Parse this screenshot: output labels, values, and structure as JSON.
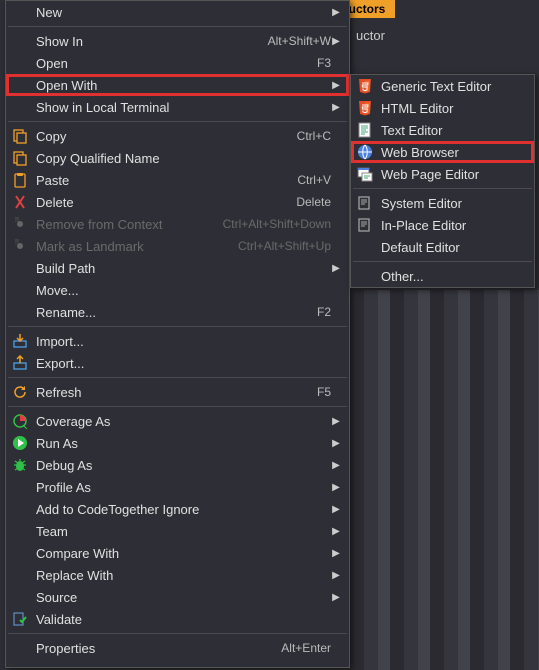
{
  "background": {
    "tab_label": "Constructors",
    "sub_label": "uctor"
  },
  "main_menu": [
    {
      "label": "New",
      "submenu": true
    },
    {
      "sep": true
    },
    {
      "label": "Show In",
      "shortcut": "Alt+Shift+W",
      "submenu": true
    },
    {
      "label": "Open",
      "shortcut": "F3"
    },
    {
      "label": "Open With",
      "submenu": true,
      "highlight": true
    },
    {
      "label": "Show in Local Terminal",
      "submenu": true
    },
    {
      "sep": true
    },
    {
      "icon": "copy",
      "label": "Copy",
      "shortcut": "Ctrl+C"
    },
    {
      "icon": "copy-q",
      "label": "Copy Qualified Name"
    },
    {
      "icon": "paste",
      "label": "Paste",
      "shortcut": "Ctrl+V"
    },
    {
      "icon": "delete",
      "label": "Delete",
      "shortcut": "Delete"
    },
    {
      "icon": "remove-ctx",
      "label": "Remove from Context",
      "shortcut": "Ctrl+Alt+Shift+Down",
      "disabled": true
    },
    {
      "icon": "landmark",
      "label": "Mark as Landmark",
      "shortcut": "Ctrl+Alt+Shift+Up",
      "disabled": true
    },
    {
      "label": "Build Path",
      "submenu": true
    },
    {
      "label": "Move..."
    },
    {
      "label": "Rename...",
      "shortcut": "F2"
    },
    {
      "sep": true
    },
    {
      "icon": "import",
      "label": "Import..."
    },
    {
      "icon": "export",
      "label": "Export..."
    },
    {
      "sep": true
    },
    {
      "icon": "refresh",
      "label": "Refresh",
      "shortcut": "F5"
    },
    {
      "sep": true
    },
    {
      "icon": "coverage",
      "label": "Coverage As",
      "submenu": true
    },
    {
      "icon": "run",
      "label": "Run As",
      "submenu": true
    },
    {
      "icon": "debug",
      "label": "Debug As",
      "submenu": true
    },
    {
      "label": "Profile As",
      "submenu": true
    },
    {
      "label": "Add to CodeTogether Ignore",
      "submenu": true
    },
    {
      "label": "Team",
      "submenu": true
    },
    {
      "label": "Compare With",
      "submenu": true
    },
    {
      "label": "Replace With",
      "submenu": true
    },
    {
      "label": "Source",
      "submenu": true
    },
    {
      "icon": "validate",
      "label": "Validate"
    },
    {
      "sep": true
    },
    {
      "label": "Properties",
      "shortcut": "Alt+Enter"
    }
  ],
  "sub_menu": [
    {
      "icon": "html5",
      "label": "Generic Text Editor"
    },
    {
      "icon": "html5",
      "label": "HTML Editor"
    },
    {
      "icon": "text-ed",
      "label": "Text Editor"
    },
    {
      "icon": "globe",
      "label": "Web Browser",
      "highlight": true
    },
    {
      "icon": "webpage",
      "label": "Web Page Editor"
    },
    {
      "sep": true
    },
    {
      "icon": "system",
      "label": "System Editor"
    },
    {
      "icon": "inplace",
      "label": "In-Place Editor"
    },
    {
      "label": "Default Editor"
    },
    {
      "sep": true
    },
    {
      "label": "Other..."
    }
  ]
}
